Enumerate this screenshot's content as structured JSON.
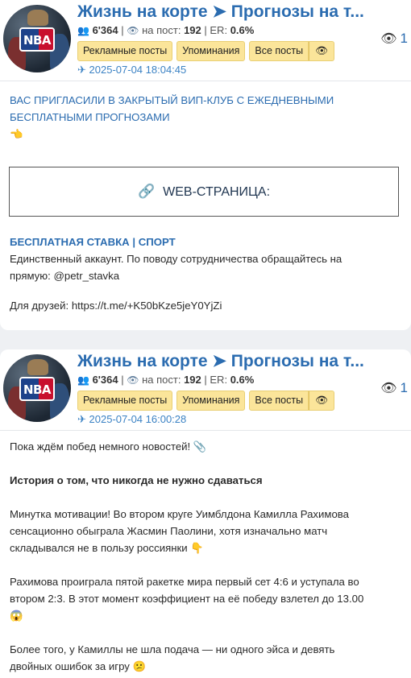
{
  "posts": [
    {
      "channel_title": "Жизнь на корте ➤ Прогнозы на т...",
      "subscribers": "6'364",
      "views_per_post_label": "на пост:",
      "views_per_post": "192",
      "er_label": "ER:",
      "er_value": "0.6%",
      "buttons": [
        "Рекламные посты",
        "Упоминания",
        "Все посты"
      ],
      "date": "2025-07-04 18:04:45",
      "views": "1",
      "avatar_text": "NBA",
      "text": {
        "invite_line1": "ВАС ПРИГЛАСИЛИ В ЗАКРЫТЫЙ ВИП-КЛУБ С ЕЖЕДНЕВНЫМИ",
        "invite_line2": "БЕСПЛАТНЫМИ ПРОГНОЗАМИ",
        "hand_emoji": "👈",
        "web_button": "WEB-СТРАНИЦА:",
        "subhead": "БЕСПЛАТНАЯ СТАВКА | СПОРТ",
        "desc_line1": "Единственный аккаунт. По поводу сотрудничества обращайтесь на",
        "desc_line2": "прямую: @petr_stavka",
        "friends": "Для друзей: https://t.me/+K50bKze5jeY0YjZi"
      }
    },
    {
      "channel_title": "Жизнь на корте ➤ Прогнозы на т...",
      "subscribers": "6'364",
      "views_per_post_label": "на пост:",
      "views_per_post": "192",
      "er_label": "ER:",
      "er_value": "0.6%",
      "buttons": [
        "Рекламные посты",
        "Упоминания",
        "Все посты"
      ],
      "date": "2025-07-04 16:00:28",
      "views": "1",
      "avatar_text": "NBA",
      "text": {
        "p1": "Пока ждём побед немного новостей! 📎",
        "p2": "История о том, что никогда не нужно сдаваться",
        "p3_l1": "Минутка мотивации! Во втором круге Уимблдона Камилла Рахимова",
        "p3_l2": "сенсационно обыграла Жасмин Паолини, хотя изначально матч",
        "p3_l3": "складывался не в пользу россиянки 👇",
        "p4_l1": "Рахимова проиграла пятой ракетке мира первый сет 4:6 и уступала во",
        "p4_l2": "втором 2:3. В этот момент коэффициент на её победу взлетел до 13.00",
        "p4_l3": "😱",
        "p5_l1": "Более того, у Камиллы не шла подача — ни одного эйса и девять",
        "p5_l2": "двойных ошибок за игру 😕"
      }
    }
  ],
  "colors": {
    "accent": "#2b6cb0",
    "button_bg": "#fbe59a",
    "date": "#3b82c4"
  },
  "icons": {
    "subscribers": "users-icon",
    "views": "eye-icon",
    "date": "send-icon",
    "link": "chain-link-icon"
  }
}
